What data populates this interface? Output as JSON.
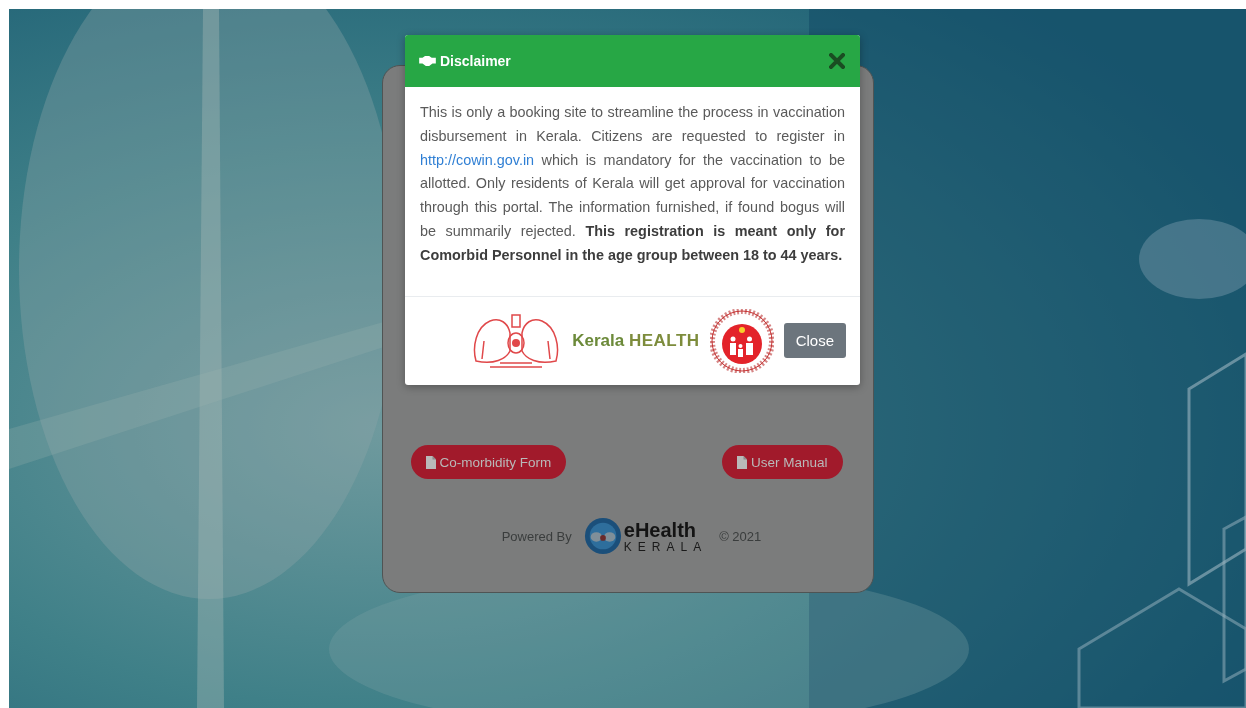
{
  "card": {
    "buttons": [
      {
        "label": "Co-morbidity Form"
      },
      {
        "label": "User Manual"
      }
    ],
    "footer": {
      "powered_by": "Powered By",
      "logo_name": "eHealth",
      "logo_subtitle": "KERALA",
      "copyright": "© 2021"
    }
  },
  "modal": {
    "title": "Disclaimer",
    "body": {
      "before": "This is only a booking site to streamline the process in vaccination disbursement in Kerala. Citizens are requested to register in ",
      "link": "http://cowin.gov.in",
      "after": " which is mandatory for the vaccination to be allotted. Only residents of Kerala will get approval for vaccination through this portal. The information furnished, if found bogus will be summarily rejected. **This registration is meant only for Comorbid Personnel in the age group between 18 to 44 years.**"
    },
    "brand": {
      "first": "Kerala",
      "second": "HEALTH"
    },
    "close_button": "Close"
  }
}
